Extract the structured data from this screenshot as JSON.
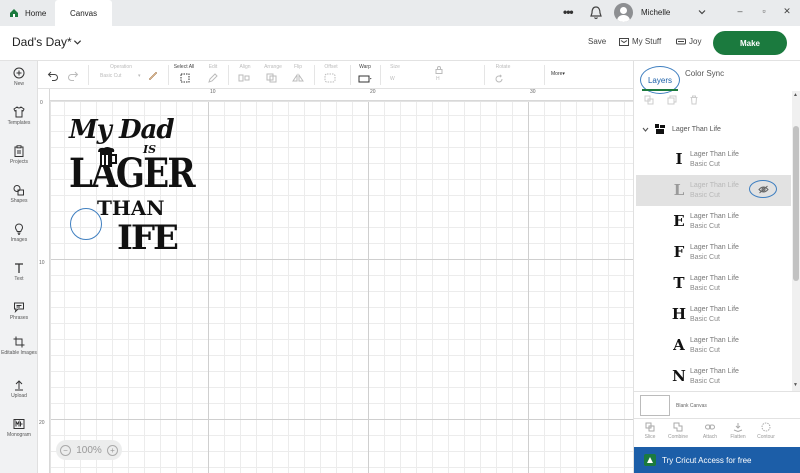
{
  "tabs": {
    "home": "Home",
    "canvas": "Canvas"
  },
  "user": {
    "name": "Michelle"
  },
  "window": {
    "minimize": "–",
    "restore": "▫",
    "close": "✕"
  },
  "header": {
    "project_title": "Dad's Day*",
    "save": "Save",
    "my_stuff": "My Stuff",
    "joy": "Joy",
    "make": "Make"
  },
  "sidebar": {
    "items": [
      "New",
      "Templates",
      "Projects",
      "Shapes",
      "Images",
      "Text",
      "Phrases",
      "Editable Images",
      "Upload",
      "Monogram"
    ]
  },
  "toolbar": {
    "operation_label": "Operation",
    "operation_value": "Basic Cut",
    "select_all": "Select All",
    "edit": "Edit",
    "align": "Align",
    "arrange": "Arrange",
    "flip": "Flip",
    "offset": "Offset",
    "warp": "Warp",
    "size": "Size",
    "w": "W",
    "h": "H",
    "rotate": "Rotate",
    "more": "More▾"
  },
  "ruler": {
    "top": [
      "0",
      "10",
      "20",
      "30"
    ],
    "left": [
      "0",
      "10",
      "20"
    ]
  },
  "design": {
    "line1": "My Dad",
    "line2": "IS",
    "line3": "LAGER",
    "line4": "THAN",
    "line5": "IFE"
  },
  "zoom": {
    "minus": "−",
    "value": "100%",
    "plus": "+"
  },
  "panel": {
    "tab_layers": "Layers",
    "tab_color_sync": "Color Sync",
    "group_name": "Lager Than Life",
    "layers": [
      {
        "glyph": "I",
        "name": "Lager Than Life",
        "sub": "Basic Cut"
      },
      {
        "glyph": "L",
        "name": "Lager Than Life",
        "sub": "Basic Cut"
      },
      {
        "glyph": "E",
        "name": "Lager Than Life",
        "sub": "Basic Cut"
      },
      {
        "glyph": "F",
        "name": "Lager Than Life",
        "sub": "Basic Cut"
      },
      {
        "glyph": "T",
        "name": "Lager Than Life",
        "sub": "Basic Cut"
      },
      {
        "glyph": "H",
        "name": "Lager Than Life",
        "sub": "Basic Cut"
      },
      {
        "glyph": "A",
        "name": "Lager Than Life",
        "sub": "Basic Cut"
      },
      {
        "glyph": "N",
        "name": "Lager Than Life",
        "sub": "Basic Cut"
      }
    ],
    "blank_canvas": "Blank Canvas",
    "bottom_actions": [
      "Slice",
      "Combine",
      "Attach",
      "Flatten",
      "Contour"
    ],
    "cricut_access": "Try Cricut Access for free"
  },
  "colors": {
    "make": "#1b7a3e",
    "access": "#1c5ea8",
    "highlight": "#3f7fc0"
  }
}
